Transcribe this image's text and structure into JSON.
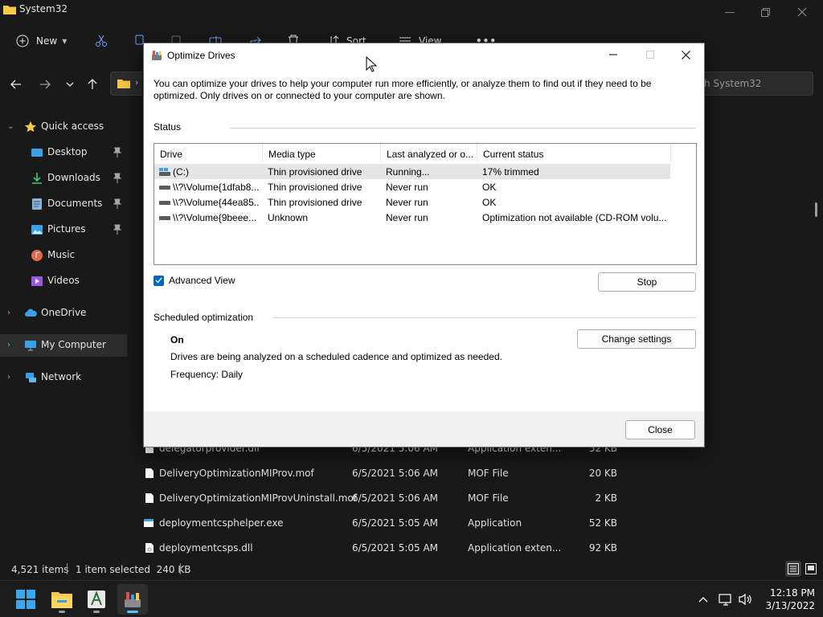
{
  "explorer": {
    "title": "System32",
    "toolbar": {
      "new_label": "New",
      "sort_label": "Sort",
      "view_label": "View"
    },
    "search_placeholder": "h System32",
    "sidebar": {
      "items": [
        {
          "label": "Quick access",
          "icon": "star-icon"
        },
        {
          "label": "Desktop",
          "icon": "desktop-icon",
          "pinned": true
        },
        {
          "label": "Downloads",
          "icon": "download-icon",
          "pinned": true
        },
        {
          "label": "Documents",
          "icon": "documents-icon",
          "pinned": true
        },
        {
          "label": "Pictures",
          "icon": "pictures-icon",
          "pinned": true
        },
        {
          "label": "Music",
          "icon": "music-icon"
        },
        {
          "label": "Videos",
          "icon": "videos-icon"
        },
        {
          "label": "OneDrive",
          "icon": "cloud-icon"
        },
        {
          "label": "My Computer",
          "icon": "computer-icon",
          "selected": true
        },
        {
          "label": "Network",
          "icon": "network-icon"
        }
      ]
    },
    "files": [
      {
        "name": "delegatorprovider.dll",
        "date": "6/5/2021 5:06 AM",
        "type": "Application exten...",
        "size": "52 KB"
      },
      {
        "name": "DeliveryOptimizationMIProv.mof",
        "date": "6/5/2021 5:06 AM",
        "type": "MOF File",
        "size": "20 KB"
      },
      {
        "name": "DeliveryOptimizationMIProvUninstall.mof",
        "date": "6/5/2021 5:06 AM",
        "type": "MOF File",
        "size": "2 KB"
      },
      {
        "name": "deploymentcsphelper.exe",
        "date": "6/5/2021 5:05 AM",
        "type": "Application",
        "size": "52 KB"
      },
      {
        "name": "deploymentcsps.dll",
        "date": "6/5/2021 5:05 AM",
        "type": "Application exten...",
        "size": "92 KB"
      }
    ],
    "status": {
      "items": "4,521 items",
      "selected": "1 item selected  240 KB"
    }
  },
  "dialog": {
    "title": "Optimize Drives",
    "intro": "You can optimize your drives to help your computer run more efficiently, or analyze them to find out if they need to be optimized. Only drives on or connected to your computer are shown.",
    "status_label": "Status",
    "columns": [
      "Drive",
      "Media type",
      "Last analyzed or o...",
      "Current status"
    ],
    "drives": [
      {
        "drive": "(C:)",
        "media": "Thin provisioned drive",
        "last": "Running...",
        "status": "17% trimmed",
        "icon": "system-drive-icon",
        "selected": true
      },
      {
        "drive": "\\\\?\\Volume{1dfab8...",
        "media": "Thin provisioned drive",
        "last": "Never run",
        "status": "OK",
        "icon": "drive-icon"
      },
      {
        "drive": "\\\\?\\Volume{44ea85...",
        "media": "Thin provisioned drive",
        "last": "Never run",
        "status": "OK",
        "icon": "drive-icon"
      },
      {
        "drive": "\\\\?\\Volume{9beee...",
        "media": "Unknown",
        "last": "Never run",
        "status": "Optimization not available (CD-ROM volu...",
        "icon": "drive-icon"
      }
    ],
    "advanced_view_label": "Advanced View",
    "advanced_view_checked": true,
    "stop_label": "Stop",
    "scheduled_label": "Scheduled optimization",
    "scheduled_state": "On",
    "scheduled_desc": "Drives are being analyzed on a scheduled cadence and optimized as needed.",
    "frequency": "Frequency: Daily",
    "change_settings_label": "Change settings",
    "close_label": "Close"
  },
  "taskbar": {
    "apps": [
      "start-icon",
      "file-explorer-icon",
      "font-app-icon",
      "optimize-drives-icon"
    ],
    "time": "12:18 PM",
    "date": "3/13/2022"
  },
  "colors": {
    "accent": "#0067c0",
    "explorer_bg": "#191919",
    "folder": "#f8c848"
  }
}
